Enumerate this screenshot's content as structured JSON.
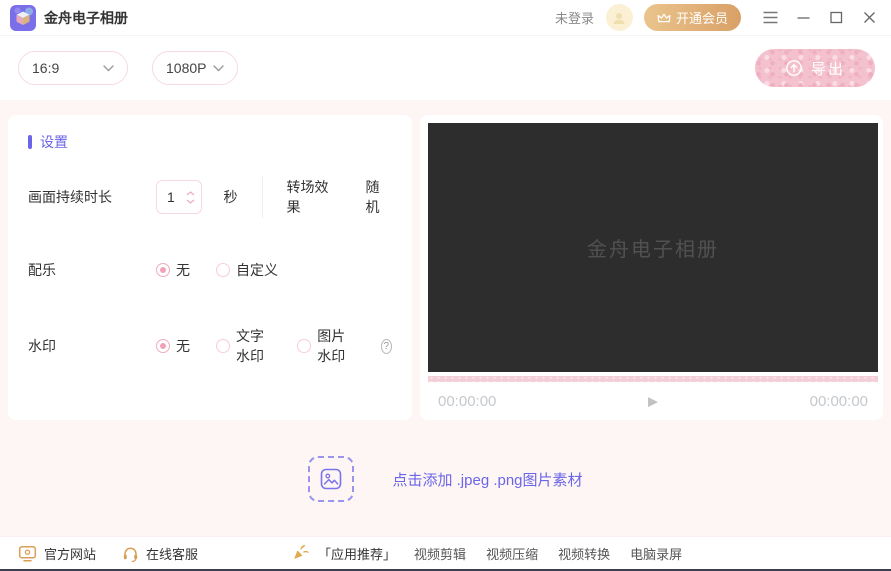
{
  "titlebar": {
    "app_title": "金舟电子相册",
    "login_status": "未登录",
    "vip_button": "开通会员"
  },
  "toolbar": {
    "aspect_ratio": "16:9",
    "resolution": "1080P",
    "export_label": "导出"
  },
  "settings": {
    "header": "设置",
    "duration": {
      "label": "画面持续时长",
      "value": "1",
      "unit": "秒"
    },
    "transition": {
      "label": "转场效果",
      "value": "随机"
    },
    "music": {
      "label": "配乐",
      "options": [
        "无",
        "自定义"
      ],
      "selected": "无"
    },
    "watermark": {
      "label": "水印",
      "options": [
        "无",
        "文字水印",
        "图片水印"
      ],
      "selected": "无"
    }
  },
  "preview": {
    "placeholder": "金舟电子相册",
    "current_time": "00:00:00",
    "total_time": "00:00:00",
    "progress_percent": 0
  },
  "add_media": {
    "hint": "点击添加 .jpeg .png图片素材"
  },
  "footer": {
    "website": "官方网站",
    "support": "在线客服",
    "recommend_title": "「应用推荐」",
    "links": [
      "视频剪辑",
      "视频压缩",
      "视频转换",
      "电脑录屏"
    ]
  },
  "icons": {
    "play": "▶",
    "help": "?"
  },
  "colors": {
    "accent_purple": "#6B65E8",
    "pink_border": "#F7D9E0",
    "pink_button": "#F4C1CE",
    "vip_gold": "#D9A066",
    "preview_bg": "#2D2D2D",
    "page_bg": "#FDF6F5"
  }
}
